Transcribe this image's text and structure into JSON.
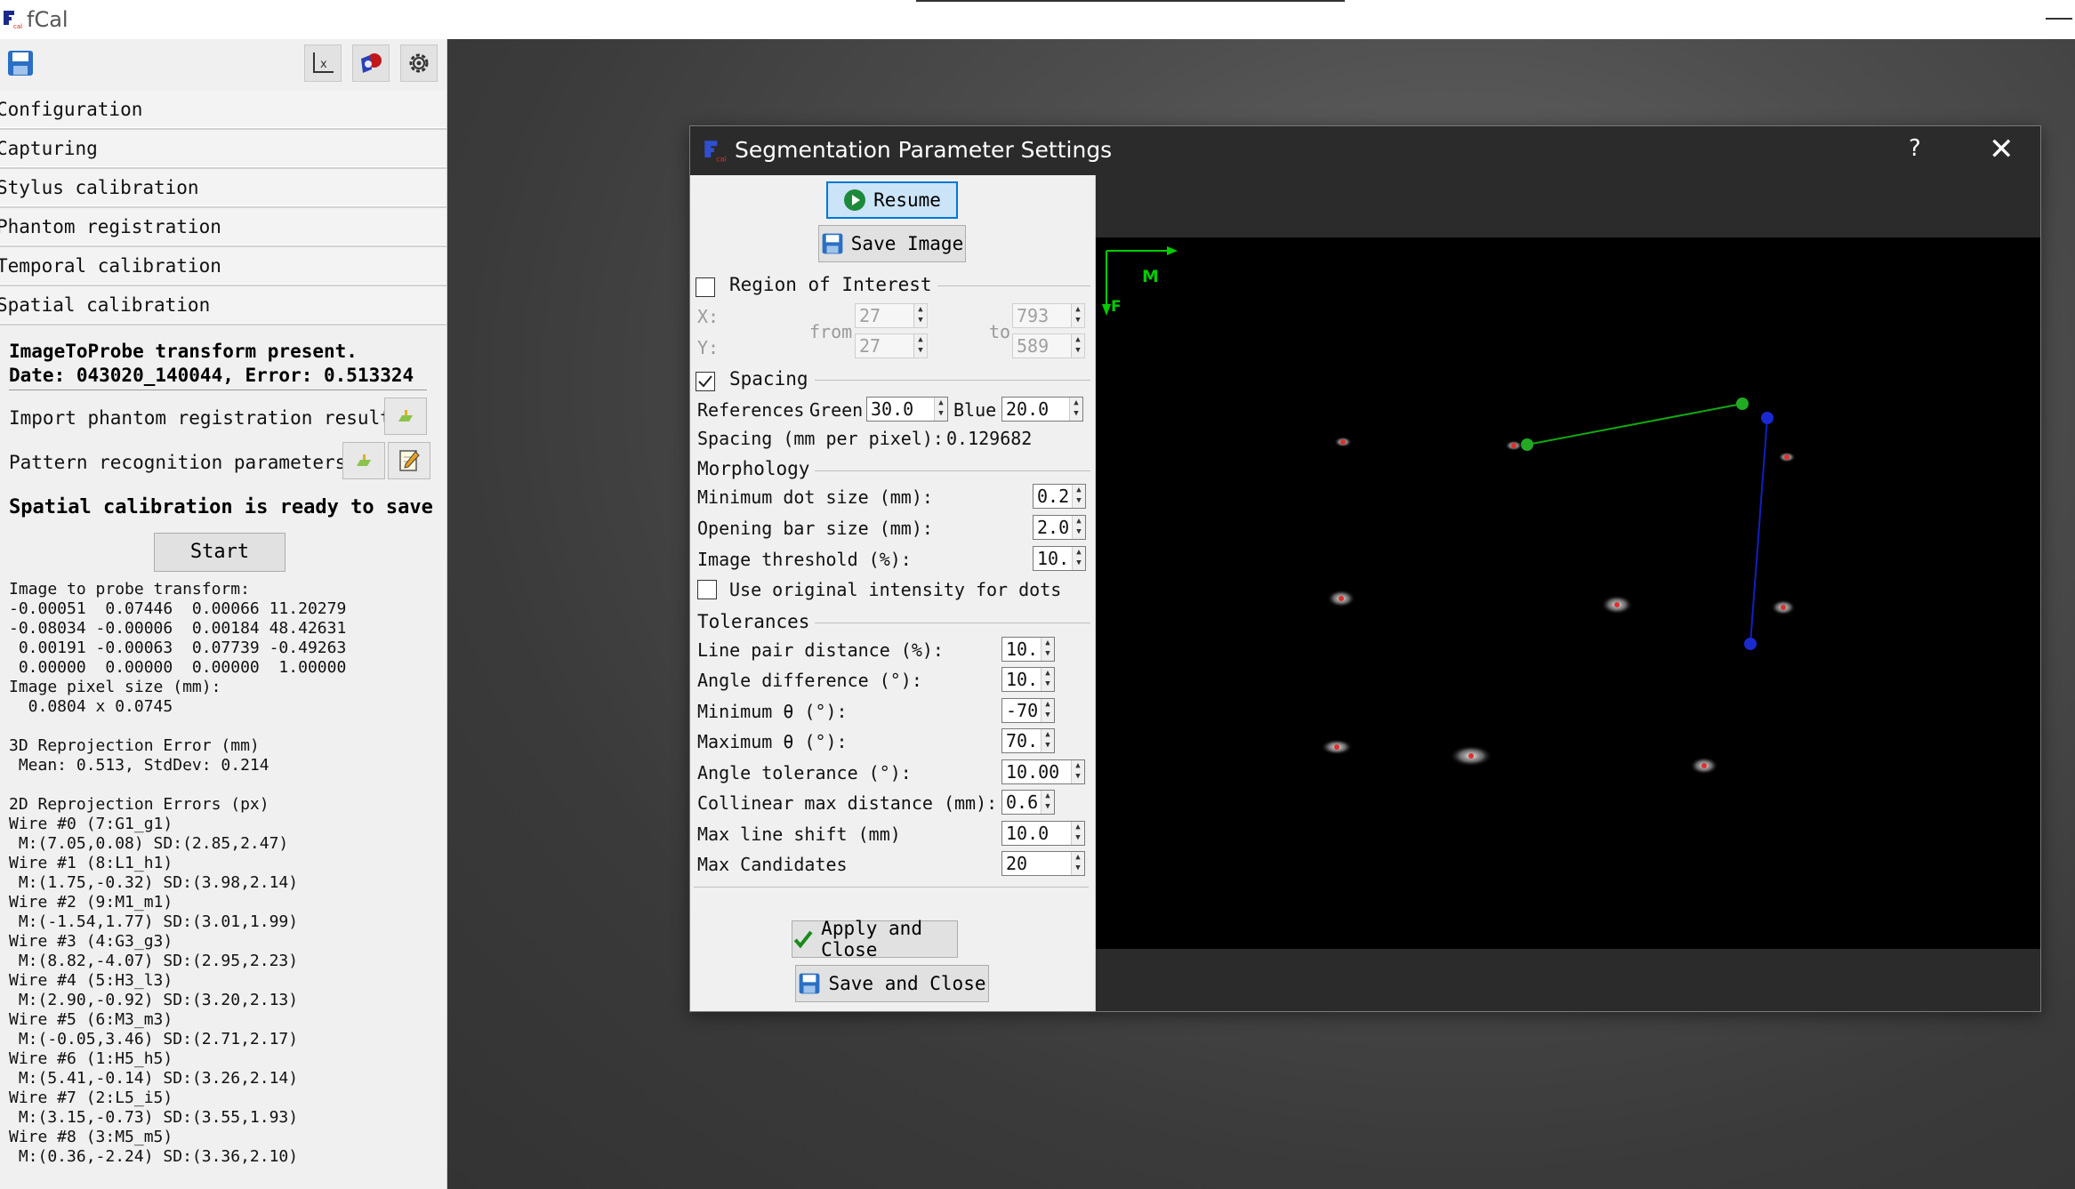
{
  "app": {
    "title": "fCal"
  },
  "left_panel": {
    "sections": [
      "Configuration",
      "Capturing",
      "Stylus calibration",
      "Phantom registration",
      "Temporal calibration",
      "Spatial calibration"
    ],
    "status_line1": "ImageToProbe transform present.",
    "status_line2": "Date: 043020_140044, Error: 0.513324",
    "import_label": "Import phantom registration result:",
    "pattern_label": "Pattern recognition parameters:",
    "ready_text": "Spatial calibration is ready to save",
    "start_label": "Start",
    "results_text": "Image to probe transform:\n-0.00051  0.07446  0.00066 11.20279\n-0.08034 -0.00006  0.00184 48.42631\n 0.00191 -0.00063  0.07739 -0.49263\n 0.00000  0.00000  0.00000  1.00000\nImage pixel size (mm):\n  0.0804 x 0.0745\n\n3D Reprojection Error (mm)\n Mean: 0.513, StdDev: 0.214\n\n2D Reprojection Errors (px)\nWire #0 (7:G1_g1)\n M:(7.05,0.08) SD:(2.85,2.47)\nWire #1 (8:L1_h1)\n M:(1.75,-0.32) SD:(3.98,2.14)\nWire #2 (9:M1_m1)\n M:(-1.54,1.77) SD:(3.01,1.99)\nWire #3 (4:G3_g3)\n M:(8.82,-4.07) SD:(2.95,2.23)\nWire #4 (5:H3_l3)\n M:(2.90,-0.92) SD:(3.20,2.13)\nWire #5 (6:M3_m3)\n M:(-0.05,3.46) SD:(2.71,2.17)\nWire #6 (1:H5_h5)\n M:(5.41,-0.14) SD:(3.26,2.14)\nWire #7 (2:L5_i5)\n M:(3.15,-0.73) SD:(3.55,1.93)\nWire #8 (3:M5_m5)\n M:(0.36,-2.24) SD:(3.36,2.10)"
  },
  "dialog": {
    "title": "Segmentation Parameter Settings",
    "help": "?",
    "close": "✕",
    "resume_label": "Resume",
    "save_image_label": "Save Image",
    "roi": {
      "title": "Region of Interest",
      "checked": false,
      "x_label": "X:",
      "y_label": "Y:",
      "from_label": "from",
      "to_label": "to",
      "x_from": "27",
      "y_from": "27",
      "x_to": "793",
      "y_to": "589"
    },
    "spacing": {
      "title": "Spacing",
      "checked": true,
      "references_label": "References",
      "green_label": "Green",
      "green_value": "30.0",
      "blue_label": "Blue",
      "blue_value": "20.0",
      "spacing_label": "Spacing (mm per pixel):",
      "spacing_value": "0.129682"
    },
    "morphology": {
      "title": "Morphology",
      "min_dot_label": "Minimum dot size (mm):",
      "min_dot_value": "0.2",
      "opening_bar_label": "Opening bar size (mm):",
      "opening_bar_value": "2.0",
      "threshold_label": "Image threshold (%):",
      "threshold_value": "10.",
      "orig_intensity_label": "Use original intensity for dots",
      "orig_intensity_checked": false
    },
    "tolerances": {
      "title": "Tolerances",
      "rows": [
        {
          "label": "Line pair distance (%):",
          "value": "10."
        },
        {
          "label": "Angle difference (°):",
          "value": "10."
        },
        {
          "label": "Minimum θ (°):",
          "value": "-70."
        },
        {
          "label": "Maximum θ (°):",
          "value": "70."
        },
        {
          "label": "Angle tolerance (°):",
          "value": "10.00"
        },
        {
          "label": "Collinear max distance (mm):",
          "value": "0.6"
        },
        {
          "label": "Max line shift (mm)",
          "value": "10.0"
        },
        {
          "label": "Max Candidates",
          "value": "20"
        }
      ]
    },
    "apply_label": "Apply and Close",
    "save_close_label": "Save and Close",
    "viewer": {
      "axis_m_label": "M",
      "axis_f_label": "F",
      "colors": {
        "axis": "#00cc00",
        "green_line": "#11aa11",
        "blue_line": "#1020c0",
        "dot": "#e03030"
      }
    }
  }
}
